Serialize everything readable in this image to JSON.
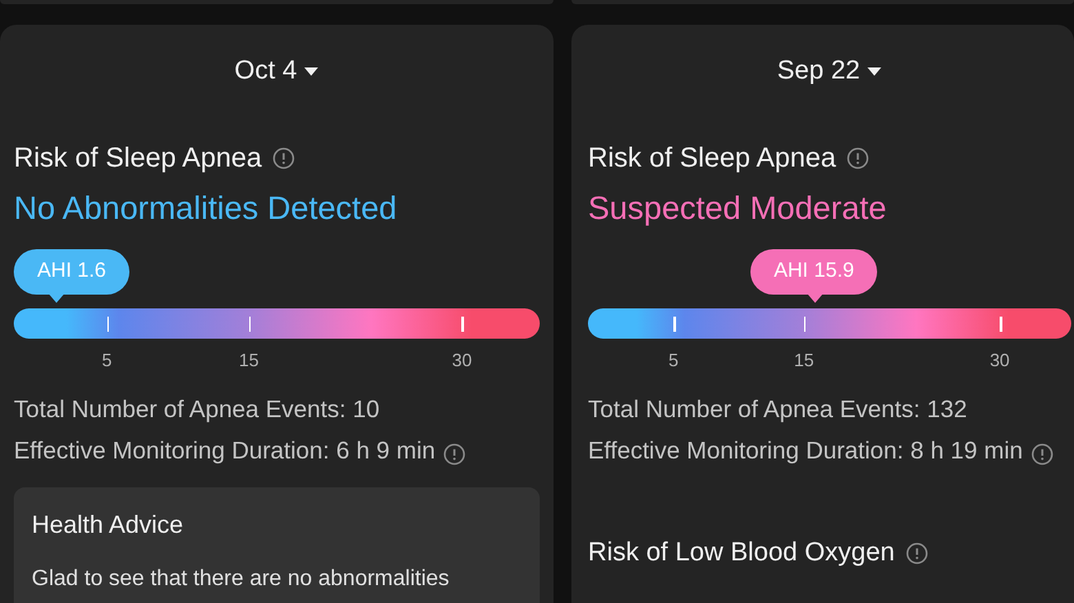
{
  "reports": [
    {
      "date": "Oct 4",
      "title": "Risk of Sleep Apnea",
      "result": "No Abnormalities Detected",
      "color": "#4ab8f5",
      "ahi": "AHI 1.6",
      "level": 0.082,
      "ticks": [
        "5",
        "15",
        "30"
      ],
      "stats": [
        {
          "text": "Total Number of Apnea Events: 10",
          "info": false
        },
        {
          "text": "Effective Monitoring Duration: 6 h 9 min",
          "info": true
        }
      ],
      "advice": {
        "title": "Health Advice",
        "text": "Glad to see that there are no abnormalities"
      }
    },
    {
      "date": "Sep 22",
      "title": "Risk of Sleep Apnea",
      "result": "Suspected Moderate",
      "color": "#f56fb6",
      "ahi": "AHI 15.9",
      "level": 0.47,
      "ticks": [
        "5",
        "15",
        "30"
      ],
      "stats": [
        {
          "text": "Total Number of Apnea Events: 132",
          "info": false
        },
        {
          "text": "Effective Monitoring Duration: 8 h 19 min",
          "info": true
        }
      ],
      "next_section": "Risk of Low Blood Oxygen"
    }
  ]
}
